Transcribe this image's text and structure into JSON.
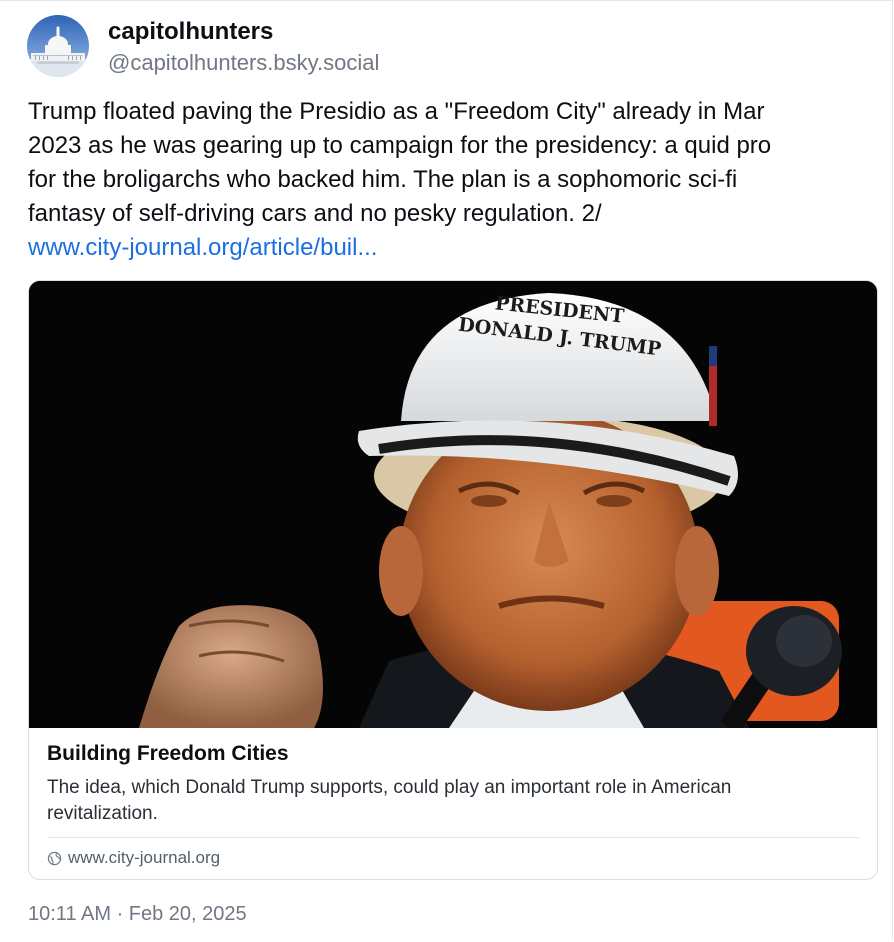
{
  "post": {
    "author": {
      "display_name": "capitolhunters",
      "handle": "@capitolhunters.bsky.social",
      "avatar_icon": "capitol-building-avatar"
    },
    "text_lines": [
      "Trump floated paving the Presidio as a \"Freedom City\" already in Mar",
      "2023 as he was gearing up to campaign for the presidency: a quid pro",
      "for the broligarchs who backed him. The plan is a sophomoric sci-fi",
      "fantasy of self-driving cars and no pesky regulation. 2/"
    ],
    "link_text": "www.city-journal.org/article/buil...",
    "timestamp": "10:11 AM · Feb 20, 2025"
  },
  "link_card": {
    "image": {
      "helmet_text_line1": "PRESIDENT",
      "helmet_text_line2": "DONALD J. TRUMP"
    },
    "title": "Building Freedom Cities",
    "description": "The idea, which Donald Trump supports, could play an important role in American revitalization.",
    "domain": "www.city-journal.org",
    "domain_icon": "globe-icon"
  },
  "colors": {
    "link": "#1d6fe0",
    "muted_text": "#6f7883",
    "border": "#d9dee3",
    "image_background": "#050506"
  }
}
